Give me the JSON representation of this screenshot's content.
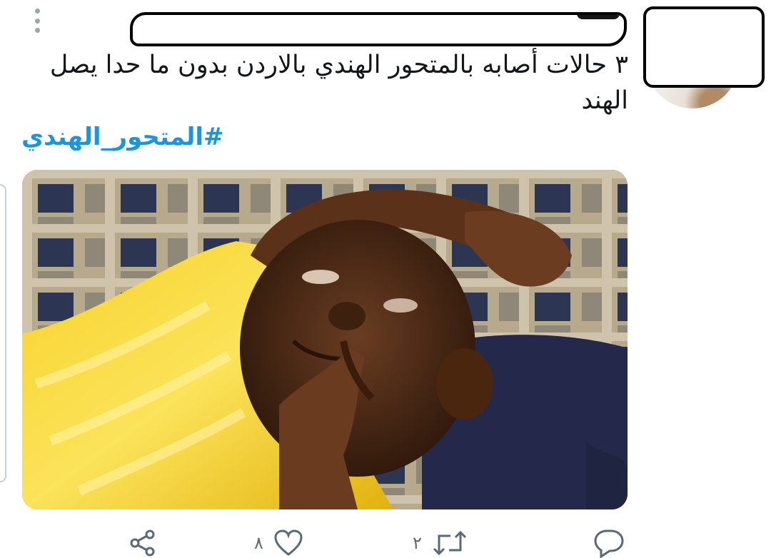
{
  "tweet": {
    "text": "٣ حالات أصابه بالمتحور الهندي بالاردن بدون ما حدا يصل الهند",
    "hashtag": "#المتحور_الهندي",
    "media_description_hidden": ""
  },
  "actions": {
    "share_icon": "share-icon",
    "like_icon": "heart-icon",
    "like_count": "٨",
    "retweet_icon": "retweet-icon",
    "retweet_count": "٢",
    "reply_icon": "reply-icon"
  },
  "colors": {
    "hashtag": "#1b95e0",
    "icon": "#5b6975",
    "text": "#14171a"
  }
}
